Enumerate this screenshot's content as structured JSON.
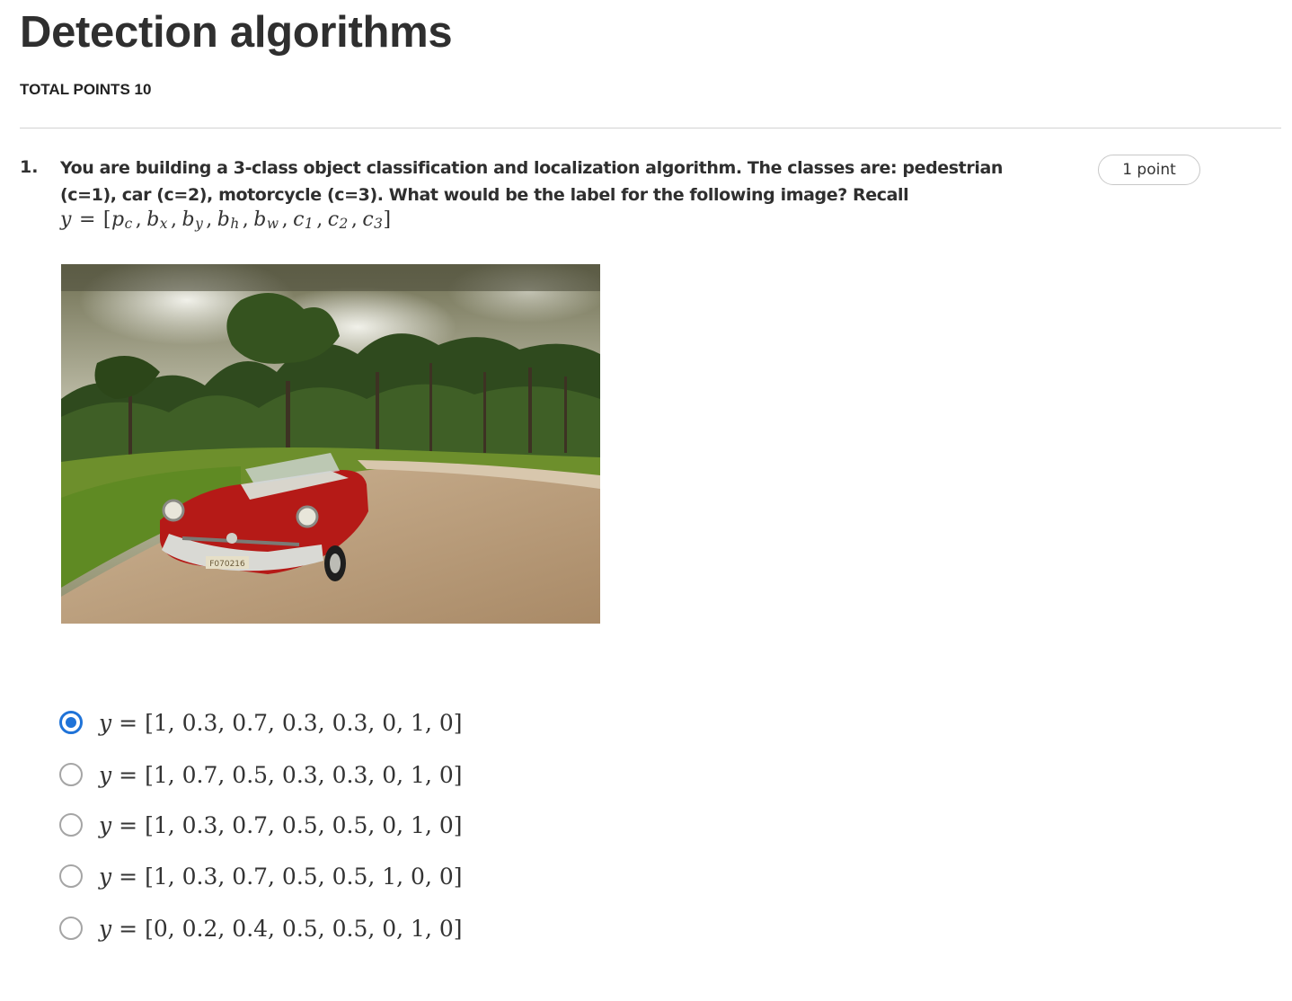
{
  "page": {
    "title": "Detection algorithms",
    "total_points": "TOTAL POINTS 10"
  },
  "question": {
    "number": "1.",
    "text": "You are building a 3-class object classification and localization algorithm. The classes are: pedestrian (c=1), car (c=2), motorcycle (c=3). What would be the label for the following image? Recall",
    "points": "1 point",
    "recall_formula": {
      "lhs": "y",
      "eq": "=",
      "open": "[",
      "items": [
        {
          "base": "p",
          "sub": "c"
        },
        {
          "base": "b",
          "sub": "x"
        },
        {
          "base": "b",
          "sub": "y"
        },
        {
          "base": "b",
          "sub": "h"
        },
        {
          "base": "b",
          "sub": "w"
        },
        {
          "base": "c",
          "sub": "1"
        },
        {
          "base": "c",
          "sub": "2"
        },
        {
          "base": "c",
          "sub": "3"
        }
      ],
      "sep": ",",
      "close": "]"
    },
    "image": {
      "description_icon": "photo-red-vintage-convertible-car-on-dirt-road",
      "plate_text": "F070216"
    },
    "options": [
      {
        "lhs": "y",
        "eq": "=",
        "value": "[1, 0.3, 0.7, 0.3, 0.3, 0, 1, 0]",
        "selected": true
      },
      {
        "lhs": "y",
        "eq": "=",
        "value": "[1, 0.7, 0.5, 0.3, 0.3, 0, 1, 0]",
        "selected": false
      },
      {
        "lhs": "y",
        "eq": "=",
        "value": "[1, 0.3, 0.7, 0.5, 0.5, 0, 1, 0]",
        "selected": false
      },
      {
        "lhs": "y",
        "eq": "=",
        "value": "[1, 0.3, 0.7, 0.5, 0.5, 1, 0, 0]",
        "selected": false
      },
      {
        "lhs": "y",
        "eq": "=",
        "value": "[0, 0.2, 0.4, 0.5, 0.5, 0, 1, 0]",
        "selected": false
      }
    ]
  },
  "colors": {
    "accent": "#1f73d8",
    "text": "#333333",
    "divider": "#d3d3d3"
  }
}
